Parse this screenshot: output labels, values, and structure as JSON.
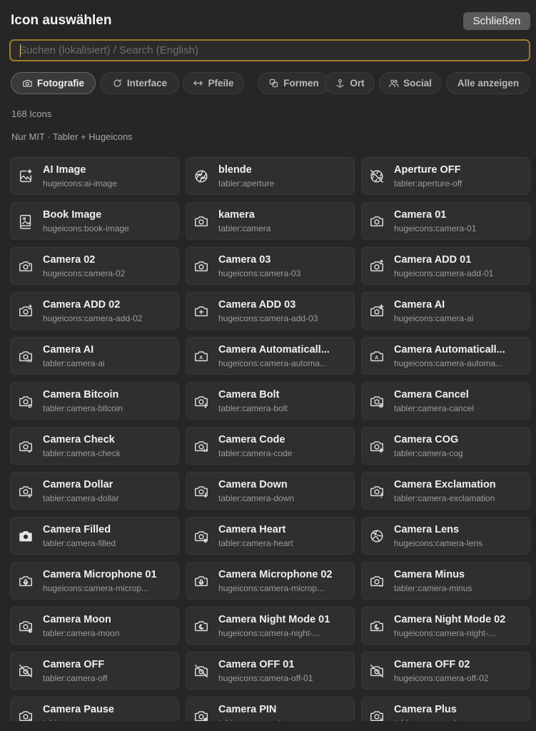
{
  "header": {
    "title": "Icon auswählen",
    "close_label": "Schließen"
  },
  "search": {
    "placeholder": "Suchen (lokalisiert) / Search (English)",
    "value": ""
  },
  "tabs": [
    {
      "label": "Fotografie",
      "icon": "camera-icon",
      "active": true
    },
    {
      "label": "Interface",
      "icon": "refresh-icon",
      "active": false
    },
    {
      "label": "Pfeile",
      "icon": "arrows-horizontal-icon",
      "active": false
    },
    {
      "label": "Formen",
      "icon": "shapes-icon",
      "active": false
    },
    {
      "label": "Ort",
      "icon": "location-pin-icon",
      "active": false
    },
    {
      "label": "Social",
      "icon": "users-icon",
      "active": false
    },
    {
      "label": "Alle anzeigen",
      "icon": "",
      "active": false
    }
  ],
  "count_text": "168 Icons",
  "license_text": "Nur MIT · Tabler + Hugeicons",
  "icons": [
    {
      "name": "AI Image",
      "code": "hugeicons:ai-image",
      "icon": "ai-image-icon"
    },
    {
      "name": "blende",
      "code": "tabler:aperture",
      "icon": "aperture-icon"
    },
    {
      "name": "Aperture OFF",
      "code": "tabler:aperture-off",
      "icon": "aperture-off-icon"
    },
    {
      "name": "Book Image",
      "code": "hugeicons:book-image",
      "icon": "book-image-icon"
    },
    {
      "name": "kamera",
      "code": "tabler:camera",
      "icon": "camera-icon"
    },
    {
      "name": "Camera 01",
      "code": "hugeicons:camera-01",
      "icon": "camera-01-icon"
    },
    {
      "name": "Camera 02",
      "code": "hugeicons:camera-02",
      "icon": "camera-02-icon"
    },
    {
      "name": "Camera 03",
      "code": "hugeicons:camera-03",
      "icon": "camera-03-icon"
    },
    {
      "name": "Camera ADD 01",
      "code": "hugeicons:camera-add-01",
      "icon": "camera-add-01-icon"
    },
    {
      "name": "Camera ADD 02",
      "code": "hugeicons:camera-add-02",
      "icon": "camera-add-02-icon"
    },
    {
      "name": "Camera ADD 03",
      "code": "hugeicons:camera-add-03",
      "icon": "camera-add-03-icon"
    },
    {
      "name": "Camera AI",
      "code": "hugeicons:camera-ai",
      "icon": "camera-ai-sparkle-icon"
    },
    {
      "name": "Camera AI",
      "code": "tabler:camera-ai",
      "icon": "camera-ai-icon"
    },
    {
      "name": "Camera Automaticall...",
      "code": "hugeicons:camera-automa...",
      "icon": "camera-automatic-icon"
    },
    {
      "name": "Camera Automaticall...",
      "code": "hugeicons:camera-automa...",
      "icon": "camera-automatic-icon"
    },
    {
      "name": "Camera Bitcoin",
      "code": "tabler:camera-bitcoin",
      "icon": "camera-bitcoin-icon"
    },
    {
      "name": "Camera Bolt",
      "code": "tabler:camera-bolt",
      "icon": "camera-bolt-icon"
    },
    {
      "name": "Camera Cancel",
      "code": "tabler:camera-cancel",
      "icon": "camera-cancel-icon"
    },
    {
      "name": "Camera Check",
      "code": "tabler:camera-check",
      "icon": "camera-check-icon"
    },
    {
      "name": "Camera Code",
      "code": "tabler:camera-code",
      "icon": "camera-code-icon"
    },
    {
      "name": "Camera COG",
      "code": "tabler:camera-cog",
      "icon": "camera-cog-icon"
    },
    {
      "name": "Camera Dollar",
      "code": "tabler:camera-dollar",
      "icon": "camera-dollar-icon"
    },
    {
      "name": "Camera Down",
      "code": "tabler:camera-down",
      "icon": "camera-down-icon"
    },
    {
      "name": "Camera Exclamation",
      "code": "tabler:camera-exclamation",
      "icon": "camera-exclamation-icon"
    },
    {
      "name": "Camera Filled",
      "code": "tabler:camera-filled",
      "icon": "camera-filled-icon"
    },
    {
      "name": "Camera Heart",
      "code": "tabler:camera-heart",
      "icon": "camera-heart-icon"
    },
    {
      "name": "Camera Lens",
      "code": "hugeicons:camera-lens",
      "icon": "camera-lens-icon"
    },
    {
      "name": "Camera Microphone 01",
      "code": "hugeicons:camera-microp...",
      "icon": "camera-microphone-icon"
    },
    {
      "name": "Camera Microphone 02",
      "code": "hugeicons:camera-microp...",
      "icon": "camera-microphone-icon"
    },
    {
      "name": "Camera Minus",
      "code": "tabler:camera-minus",
      "icon": "camera-minus-icon"
    },
    {
      "name": "Camera Moon",
      "code": "tabler:camera-moon",
      "icon": "camera-moon-icon"
    },
    {
      "name": "Camera Night Mode 01",
      "code": "hugeicons:camera-night-...",
      "icon": "camera-night-icon"
    },
    {
      "name": "Camera Night Mode 02",
      "code": "hugeicons:camera-night-...",
      "icon": "camera-night-icon"
    },
    {
      "name": "Camera OFF",
      "code": "tabler:camera-off",
      "icon": "camera-off-icon"
    },
    {
      "name": "Camera OFF 01",
      "code": "hugeicons:camera-off-01",
      "icon": "camera-off-icon"
    },
    {
      "name": "Camera OFF 02",
      "code": "hugeicons:camera-off-02",
      "icon": "camera-off-icon"
    },
    {
      "name": "Camera Pause",
      "code": "tabler:camera-pause",
      "icon": "camera-pause-icon"
    },
    {
      "name": "Camera PIN",
      "code": "tabler:camera-pin",
      "icon": "camera-pin-icon"
    },
    {
      "name": "Camera Plus",
      "code": "tabler:camera-plus",
      "icon": "camera-plus-icon"
    }
  ]
}
